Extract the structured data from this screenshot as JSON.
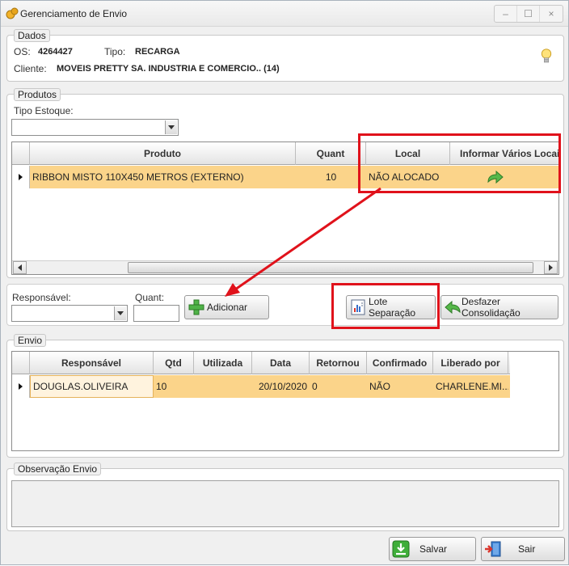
{
  "window": {
    "title": "Gerenciamento de Envio",
    "controls": [
      "–",
      "☐",
      "×"
    ]
  },
  "dados": {
    "label": "Dados",
    "os_label": "OS:",
    "os_value": "4264427",
    "tipo_label": "Tipo:",
    "tipo_value": "RECARGA",
    "cliente_label": "Cliente:",
    "cliente_value": "MOVEIS PRETTY SA. INDUSTRIA E COMERCIO.. (14)"
  },
  "produtos": {
    "label": "Produtos",
    "tipo_estoque_label": "Tipo Estoque:",
    "tipo_estoque_value": "",
    "columns": [
      "Produto",
      "Quant",
      "Local",
      "Informar Vários Locais"
    ],
    "rows": [
      {
        "produto": "RIBBON MISTO 110X450 METROS (EXTERNO)",
        "quant": "10",
        "local": "NÃO ALOCADO"
      }
    ]
  },
  "alocacao": {
    "responsavel_label": "Responsável:",
    "responsavel_value": "",
    "quant_label": "Quant:",
    "quant_value": "",
    "adicionar_label": "Adicionar",
    "lote_label": "Lote Separação",
    "desfazer_label": "Desfazer Consolidação"
  },
  "envio": {
    "label": "Envio",
    "columns": [
      "Responsável",
      "Qtd",
      "Utilizada",
      "Data",
      "Retornou",
      "Confirmado",
      "Liberado por"
    ],
    "rows": [
      {
        "responsavel": "DOUGLAS.OLIVEIRA",
        "qtd": "10",
        "utilizada": "",
        "data": "20/10/2020",
        "retornou": "0",
        "confirmado": "NÃO",
        "liberado_por": "CHARLENE.MI..."
      }
    ]
  },
  "observacao": {
    "label": "Observação Envio",
    "value": ""
  },
  "footer": {
    "salvar_label": "Salvar",
    "sair_label": "Sair"
  },
  "colors": {
    "row_highlight": "#fbd48a",
    "annotation_red": "#e0121b",
    "green_icon": "#3aa63a"
  }
}
